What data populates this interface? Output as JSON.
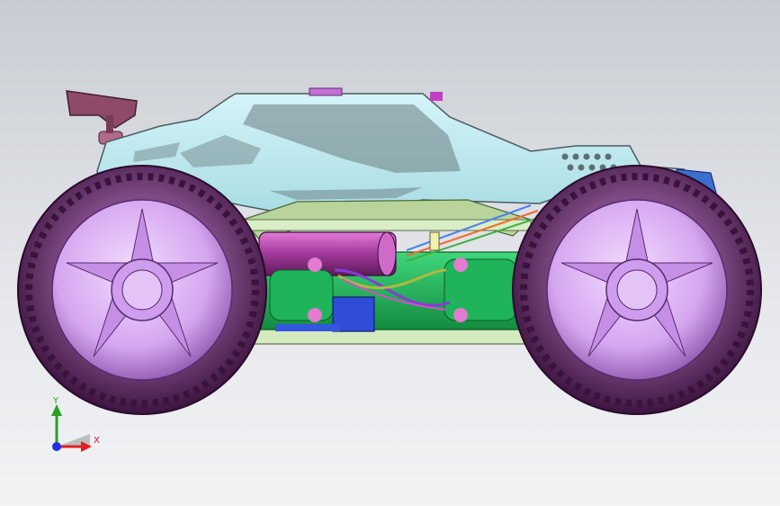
{
  "viewport": {
    "background_top": "#c8ccd2",
    "background_bottom": "#f2f3f5"
  },
  "model": {
    "part_colors": {
      "chassis_cover": "#bde8ee",
      "frame_edge": "#4a5d60",
      "wheel_rim": "#d7a8f0",
      "tire": "#5e2a62",
      "battery_pack": "#22b85a",
      "motor": "#a23d9a",
      "rails": "#c9e3b4",
      "servo_block": "#2f4dd8",
      "bumper_front": "#3a6fd0",
      "wing": "#9a5070"
    }
  },
  "triad": {
    "x_label": "X",
    "y_label": "Y",
    "x_color": "#e02020",
    "y_color": "#28a028",
    "z_color": "#2030e0"
  }
}
